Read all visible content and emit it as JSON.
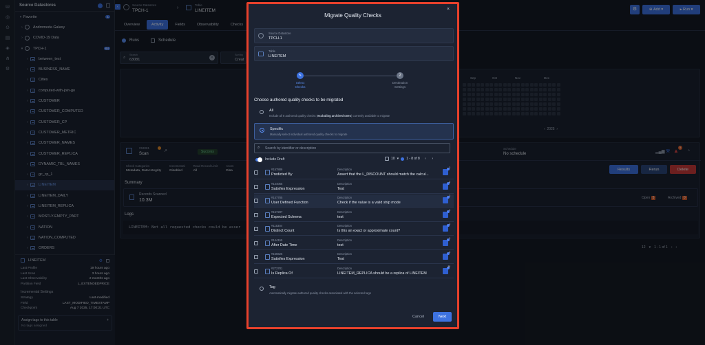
{
  "sidebar": {
    "header": "Source Datastores",
    "favorite": "Favorite",
    "favorite_count": "1",
    "datastores": [
      "Andromeda Galaxy",
      "COVID-19 Data",
      "TPCH-1"
    ],
    "tpch_count": "64",
    "tables": [
      "between_test",
      "BUSINESS_NAME",
      "Cities",
      "computed-with-join-go",
      "CUSTOMER",
      "CUSTOMER_COMPUTED",
      "CUSTOMER_CP",
      "CUSTOMER_METRIC",
      "CUSTOMER_NAMES",
      "CUSTOMER_REPLICA",
      "DYNAMIC_TBL_NAMES",
      "gc_cp_1",
      "LINEITEM",
      "LINEITEM_DAILY",
      "LINEITEM_REPLICA",
      "MOSTLY-EMPTY_PART",
      "NATION",
      "NATION_COMPUTED",
      "ORDERS"
    ],
    "selected_table": "LINEITEM",
    "info": [
      {
        "k": "Last Profile",
        "v": "19 hours ago"
      },
      {
        "k": "Last Scan",
        "v": "3 hours ago"
      },
      {
        "k": "Last Observability",
        "v": "2 months ago"
      },
      {
        "k": "Partition Field",
        "v": "L_EXTENDEDPRICE"
      }
    ],
    "incremental_title": "Incremental Settings",
    "incremental": [
      {
        "k": "Strategy",
        "v": "Last-modified"
      },
      {
        "k": "Field",
        "v": "LAST_MODIFIED_TIMESTAMP"
      },
      {
        "k": "Checkpoint",
        "v": "Aug 7 2025, 17:00:21 UTC"
      }
    ],
    "tags_title": "Assign tags to this table",
    "tags_empty": "No tags assigned"
  },
  "header": {
    "source_label": "Source Datastore",
    "source_value": "TPCH-1",
    "table_label": "Table",
    "table_value": "LINEITEM",
    "tabs": [
      "Overview",
      "Activity",
      "Fields",
      "Observability",
      "Checks"
    ],
    "active_tab": "Activity",
    "add_label": "Add",
    "run_label": "Run"
  },
  "subtabs": {
    "runs": "Runs",
    "schedule": "Schedule"
  },
  "search": {
    "label": "Search",
    "value": "63081",
    "sort_label": "Sort by",
    "sort_value": "Creat"
  },
  "heatmap": {
    "months": [
      "Sep",
      "Oct",
      "Nov",
      "Dec"
    ],
    "year": "2025"
  },
  "activity": {
    "id": "#63081",
    "type": "Scan",
    "status": "Success",
    "schedule_label": "Schedule",
    "schedule_value": "No schedule",
    "meta": [
      {
        "k": "Check Categories",
        "v": "Metadata, Data Integrity"
      },
      {
        "k": "Incremental",
        "v": "Disabled"
      },
      {
        "k": "Read Record Limit",
        "v": "All"
      },
      {
        "k": "Anom",
        "v": "Disa"
      }
    ],
    "badge": "5",
    "results_label": "Results",
    "rerun_label": "Rerun",
    "delete_label": "Delete",
    "summary_title": "Summary",
    "records_label": "Records Scanned",
    "records_value": "10.3M",
    "open_label": "Open",
    "open_count": "5",
    "archived_label": "Archived",
    "archived_count": "0",
    "logs_title": "Logs",
    "log_text": "LINEITEM: Not all requested checks could be asser",
    "pagination": "1 - 1 of 1",
    "page_size": "12"
  },
  "modal": {
    "title": "Migrate Quality Checks",
    "source_label": "Source Datastore",
    "source_value": "TPCH-1",
    "table_label": "Table",
    "table_value": "LINEITEM",
    "step1_l1": "Select",
    "step1_l2": "Checks",
    "step2_num": "2",
    "step2_l1": "Destination",
    "step2_l2": "Settings",
    "choose_title": "Choose authored quality checks to be migrated",
    "opt_all_title": "All",
    "opt_all_desc_a": "Include all 8 authored quality checks (",
    "opt_all_desc_b": "excluding archived ones",
    "opt_all_desc_c": ") currently available to migrate",
    "opt_specific_title": "Specific",
    "opt_specific_desc": "Manually select individual authored quality checks to migrate",
    "search_placeholder": "Search by identifier or description",
    "include_draft": "Include Draft",
    "page_size": "10",
    "page_range": "1 - 8 of 8",
    "desc_label": "Description",
    "items": [
      {
        "id": "#157886",
        "name": "Predicted By",
        "desc": "Assert that the L_DISCOUNT should match the calcul...",
        "badge": "1"
      },
      {
        "id": "#144065",
        "name": "Satisfies Expression",
        "desc": "Test",
        "badge": "2"
      },
      {
        "id": "#147785",
        "name": "User Defined Function",
        "desc": "Check if the value is a valid ship mode",
        "badge": "1"
      },
      {
        "id": "#157287",
        "name": "Expected Schema",
        "desc": "test",
        "badge": "1"
      },
      {
        "id": "#115304",
        "name": "Distinct Count",
        "desc": "Is this an exact or approximate count?",
        "badge": "1"
      },
      {
        "id": "#144155",
        "name": "After Date Time",
        "desc": "test",
        "badge": "1"
      },
      {
        "id": "#156626",
        "name": "Satisfies Expression",
        "desc": "Test",
        "badge": "1"
      },
      {
        "id": "#273781",
        "name": "Is Replica Of",
        "desc": "LINEITEM_REPLICA should be a replica of LINEITEM",
        "badge": "10"
      }
    ],
    "opt_tag_title": "Tag",
    "opt_tag_desc": "Automatically migrate authored quality checks associated with the selected tags",
    "cancel_label": "Cancel",
    "next_label": "Next"
  },
  "colors": {
    "accent": "#3d72e0",
    "danger": "#d64545",
    "success": "#4caf7a",
    "highlight": "#e8412c"
  }
}
